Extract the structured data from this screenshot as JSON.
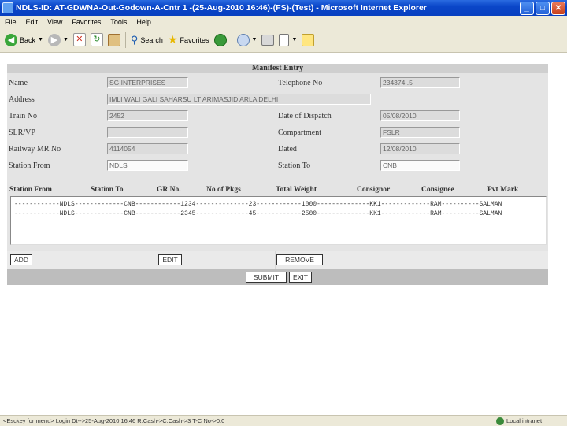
{
  "window": {
    "title": "NDLS-ID: AT-GDWNA-Out-Godown-A-Cntr 1 -(25-Aug-2010 16:46)-(FS)-(Test) - Microsoft Internet Explorer",
    "min": "_",
    "max": "□",
    "close": "✕"
  },
  "menu": [
    "File",
    "Edit",
    "View",
    "Favorites",
    "Tools",
    "Help"
  ],
  "toolbar": {
    "back": "Back",
    "search": "Search",
    "favorites": "Favorites"
  },
  "form": {
    "header": "Manifest Entry",
    "labels": {
      "name": "Name",
      "telephone": "Telephone No",
      "address": "Address",
      "train_no": "Train No",
      "date_dispatch": "Date of Dispatch",
      "slr_vp": "SLR/VP",
      "compartment": "Compartment",
      "railway_mr": "Railway MR No",
      "dated": "Dated",
      "station_from": "Station From",
      "station_to": "Station To"
    },
    "values": {
      "name": "SG INTERPRISES",
      "telephone": "234374..5",
      "address": "IMLI WALI GALI SAHARSU LT ARIMASJID ARLA DELHI",
      "train_no": "2452",
      "date_dispatch": "05/08/2010",
      "slr_vp": "",
      "compartment": "FSLR",
      "railway_mr": "4114054",
      "dated": "12/08/2010",
      "station_from": "NDLS",
      "station_to": "CNB"
    },
    "columns": [
      "Station From",
      "Station To",
      "GR No.",
      "No of Pkgs",
      "Total Weight",
      "Consignor",
      "Consignee",
      "Pvt Mark"
    ],
    "rows": [
      "------------NDLS-------------CNB------------1234--------------23------------1000--------------KK1-------------RAM----------SALMAN",
      "------------NDLS-------------CNB------------2345--------------45------------2500--------------KK1-------------RAM----------SALMAN"
    ],
    "buttons": {
      "add": "ADD",
      "edit": "EDIT",
      "remove": "REMOVE",
      "submit": "SUBMIT",
      "exit": "EXIT"
    }
  },
  "status": {
    "text": "<Esckey for menu> Login Dt-->25-Aug-2010 16:46 R:Cash->C:Cash->3 T-C No->0.0",
    "zone": "Local intranet"
  }
}
